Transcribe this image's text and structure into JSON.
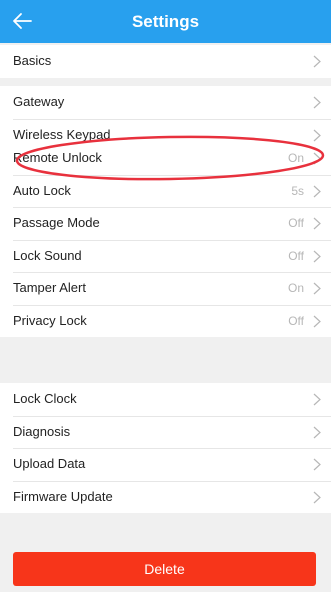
{
  "header": {
    "title": "Settings",
    "back_icon": "arrow-left-icon",
    "background": "#28a0ee"
  },
  "groups": [
    {
      "items": [
        {
          "label": "Basics",
          "value": ""
        }
      ]
    },
    {
      "items": [
        {
          "label": "Gateway",
          "value": ""
        },
        {
          "label": "Wireless Keypad",
          "value": ""
        }
      ]
    },
    {
      "items": [
        {
          "label": "Remote Unlock",
          "value": "On"
        },
        {
          "label": "Auto Lock",
          "value": "5s"
        },
        {
          "label": "Passage Mode",
          "value": "Off"
        },
        {
          "label": "Lock Sound",
          "value": "Off"
        },
        {
          "label": "Tamper Alert",
          "value": "On"
        },
        {
          "label": "Privacy Lock",
          "value": "Off"
        }
      ]
    },
    {
      "items": [
        {
          "label": "Lock Clock",
          "value": ""
        },
        {
          "label": "Diagnosis",
          "value": ""
        },
        {
          "label": "Upload Data",
          "value": ""
        },
        {
          "label": "Firmware Update",
          "value": ""
        }
      ]
    }
  ],
  "delete_button": {
    "label": "Delete",
    "color": "#f7351a"
  },
  "annotation": {
    "color": "#e8313d",
    "target": "Remote Unlock"
  }
}
